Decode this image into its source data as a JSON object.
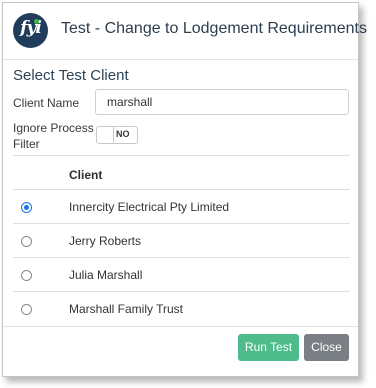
{
  "dialog": {
    "title": "Test - Change to Lodgement Requirements",
    "logo": {
      "text": "fyi",
      "icon": "fyi-logo-icon"
    }
  },
  "form": {
    "section_title": "Select Test Client",
    "client_name": {
      "label": "Client Name",
      "value": "marshall",
      "placeholder": ""
    },
    "ignore_filter": {
      "label_line1": "Ignore Process",
      "label_line2": "Filter",
      "toggle_text": "NO",
      "state": false
    }
  },
  "table": {
    "column_header": "Client",
    "rows": [
      {
        "name": "Innercity Electrical Pty Limited",
        "selected": true
      },
      {
        "name": "Jerry Roberts",
        "selected": false
      },
      {
        "name": "Julia Marshall",
        "selected": false
      },
      {
        "name": "Marshall Family Trust",
        "selected": false
      }
    ]
  },
  "actions": {
    "run_label": "Run Test",
    "close_label": "Close"
  },
  "colors": {
    "run_button": "#4dbb8a",
    "close_button": "#7a7f85",
    "logo_bg": "#223d5c",
    "radio_selected": "#1a73e8"
  }
}
